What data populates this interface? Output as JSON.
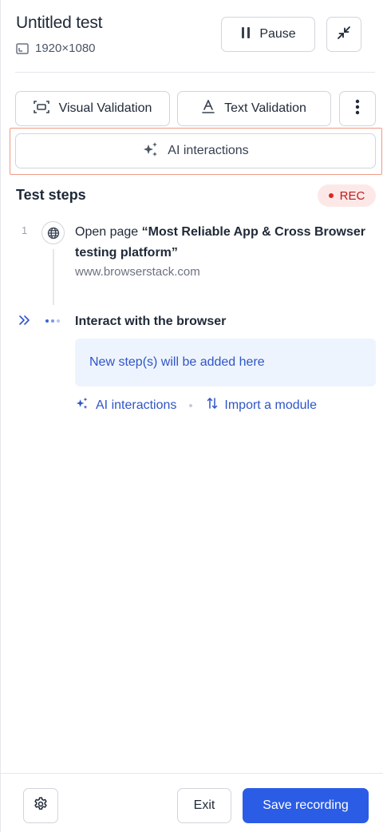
{
  "header": {
    "title": "Untitled test",
    "resolution": "1920×1080",
    "pause_label": "Pause"
  },
  "toolbar": {
    "visual_validation_label": "Visual Validation",
    "text_validation_label": "Text Validation",
    "ai_interactions_label": "AI interactions"
  },
  "steps": {
    "title": "Test steps",
    "rec_label": "REC",
    "items": [
      {
        "number": "1",
        "action": "Open page",
        "target": "“Most Reliable App & Cross Browser testing platform”",
        "url": "www.browserstack.com"
      }
    ],
    "pending": {
      "label": "Interact with the browser",
      "placeholder": "New step(s) will be added here",
      "ai_link": "AI interactions",
      "import_link": "Import a module"
    }
  },
  "footer": {
    "exit_label": "Exit",
    "save_label": "Save recording"
  },
  "colors": {
    "primary": "#2b5ce6",
    "link": "#2f55c8",
    "rec": "#b91c1c",
    "highlight_border": "#ef9a86"
  },
  "icons": [
    "resolution-icon",
    "pause-icon",
    "collapse-icon",
    "visual-validation-icon",
    "text-validation-icon",
    "more-vertical-icon",
    "sparkles-icon",
    "globe-icon",
    "double-chevron-right-icon",
    "loading-dots-icon",
    "import-arrows-icon",
    "gear-icon"
  ]
}
